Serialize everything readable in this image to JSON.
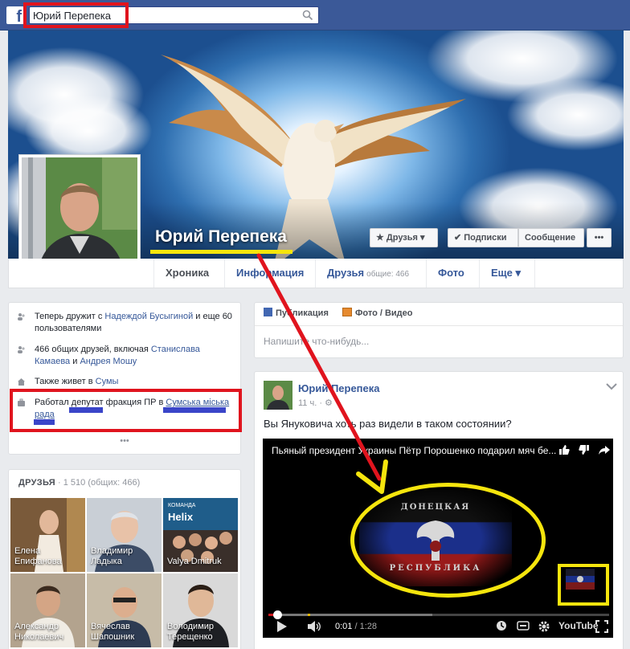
{
  "topbar": {
    "logo": "f",
    "search_value": "Юрий Перепека",
    "search_icon": "search-icon"
  },
  "profile": {
    "name": "Юрий Перепека",
    "buttons": {
      "friends": "★ Друзья ▾",
      "subscribe": "✔ Подписки",
      "message": "Сообщение",
      "more": "•••"
    }
  },
  "nav": {
    "timeline": "Хроника",
    "info": "Информация",
    "friends": "Друзья",
    "friends_sub": "общие: 466",
    "photos": "Фото",
    "more": "Еще ▾"
  },
  "intro": {
    "row1_prefix": "Теперь дружит с ",
    "row1_link": "Надеждой Бусыгиной",
    "row1_suffix": " и еще 60 пользователями",
    "row2_prefix": "466 общих друзей, включая ",
    "row2_link1": "Станислава Камаева",
    "row2_mid": " и ",
    "row2_link2": "Андрея Мошу",
    "row3_prefix": "Также живет в ",
    "row3_link": "Сумы",
    "row4_prefix": "Работал депутат фракция ПР в ",
    "row4_link": "Сумська міська рада",
    "more_dots": "•••"
  },
  "friends": {
    "title": "ДРУЗЬЯ",
    "count": " · 1 510 (общих: 466)",
    "items": [
      {
        "line1": "Елена",
        "line2": "Епифанова"
      },
      {
        "line1": "Владимир",
        "line2": "Ладыка"
      },
      {
        "line1": "",
        "line2": "Valya Dmitruk"
      },
      {
        "line1": "Александр",
        "line2": "Николаевич"
      },
      {
        "line1": "Вячеслав",
        "line2": "Шапошник"
      },
      {
        "line1": "Володимир",
        "line2": "Терещенко"
      }
    ],
    "tile3_banner_top": "КОМАНДА",
    "tile3_banner": "Helix"
  },
  "composer": {
    "tab_post": "Публикация",
    "tab_photo": "Фото / Видео",
    "placeholder": "Напишите что-нибудь..."
  },
  "post": {
    "author": "Юрий Перепека",
    "time": "11 ч. · ⚙",
    "text": "Вы Януковича хоть раз видели в таком состоянии?",
    "video": {
      "title": "Пьяный президент Украины Пётр Порошенко подарил мяч бе...",
      "time_current": "0:01",
      "time_total": " / 1:28",
      "emblem_top": "ДОНЕЦКАЯ",
      "emblem_bottom": "РЕСПУБЛИКА",
      "youtube_label": "YouTube",
      "progress": 0.02,
      "buffered": 0.48
    }
  },
  "colors": {
    "facebook_blue": "#3b5998",
    "link": "#365899",
    "annotation_red": "#e0141e",
    "annotation_yellow": "#f5e50d"
  }
}
